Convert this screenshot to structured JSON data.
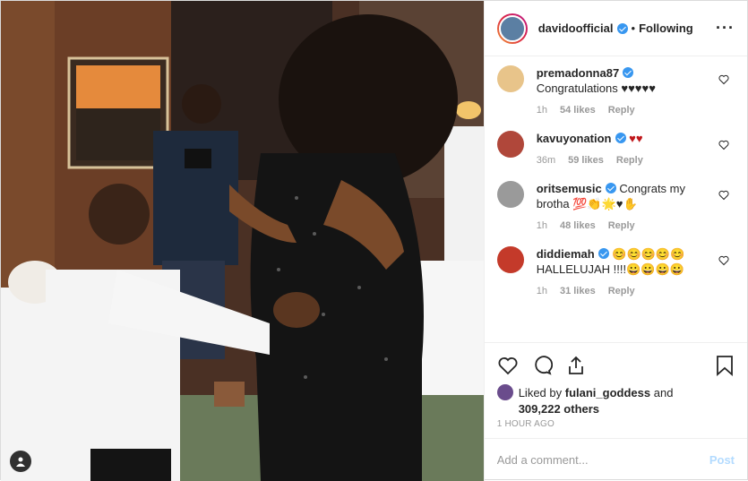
{
  "post": {
    "author": "davidoofficial",
    "separator": "•",
    "follow_status": "Following"
  },
  "comments": [
    {
      "user": "premadonna87",
      "text": "Congratulations ♥♥♥♥♥",
      "time": "1h",
      "likes": "54 likes",
      "reply": "Reply",
      "avatar_color": "#e8c48a"
    },
    {
      "user": "kavuyonation",
      "text": "♥♥",
      "time": "36m",
      "likes": "59 likes",
      "reply": "Reply",
      "avatar_color": "#b0473a"
    },
    {
      "user": "oritsemusic",
      "text": "Congrats my brotha 💯👏🌟♥✋",
      "time": "1h",
      "likes": "48 likes",
      "reply": "Reply",
      "avatar_color": "#9a9a9a"
    },
    {
      "user": "diddiemah",
      "text": "😊😊😊😊😊 HALLELUJAH !!!!😀😀😀😀",
      "time": "1h",
      "likes": "31 likes",
      "reply": "Reply",
      "avatar_color": "#c43a2a"
    }
  ],
  "likes_summary": {
    "prefix": "Liked by",
    "user": "fulani_goddess",
    "and": "and",
    "others": "309,222 others"
  },
  "timestamp": "1 HOUR AGO",
  "comment_box": {
    "placeholder": "Add a comment...",
    "post_label": "Post"
  },
  "colors": {
    "verified": "#3897f0",
    "heart": "#c0171b",
    "post_disabled": "#b3dbff"
  }
}
